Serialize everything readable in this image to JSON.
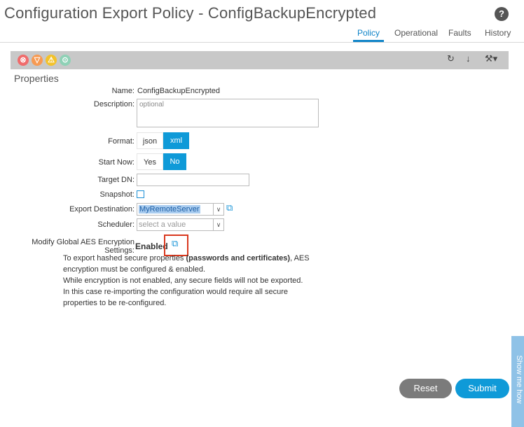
{
  "header": {
    "title": "Configuration Export Policy - ConfigBackupEncrypted",
    "help": "?"
  },
  "tabs": [
    {
      "label": "Policy",
      "active": true
    },
    {
      "label": "Operational",
      "active": false
    },
    {
      "label": "Faults",
      "active": false
    },
    {
      "label": "History",
      "active": false
    }
  ],
  "toolbar": {
    "faults": [
      {
        "icon": "critical-fault-icon",
        "color": "#f06b6b",
        "glyph": "⊗"
      },
      {
        "icon": "major-fault-icon",
        "color": "#f79a52",
        "glyph": "▽"
      },
      {
        "icon": "minor-fault-icon",
        "color": "#f3c22a",
        "glyph": "⚠"
      },
      {
        "icon": "warning-fault-icon",
        "color": "#8fd1b6",
        "glyph": "⊙"
      }
    ],
    "actions": {
      "refresh": "↻",
      "download": "↓",
      "tools": "⚒▾"
    }
  },
  "properties": {
    "section_title": "Properties",
    "name": {
      "label": "Name:",
      "value": "ConfigBackupEncrypted"
    },
    "description": {
      "label": "Description:",
      "placeholder": "optional"
    },
    "format": {
      "label": "Format:",
      "options": [
        "json",
        "xml"
      ],
      "selected": "xml"
    },
    "start_now": {
      "label": "Start Now:",
      "options": [
        "Yes",
        "No"
      ],
      "selected": "No"
    },
    "target_dn": {
      "label": "Target DN:",
      "value": ""
    },
    "snapshot": {
      "label": "Snapshot:",
      "checked": false
    },
    "export_destination": {
      "label": "Export Destination:",
      "value": "MyRemoteServer"
    },
    "scheduler": {
      "label": "Scheduler:",
      "placeholder": "select a value"
    },
    "aes": {
      "label_line1": "Modify Global AES Encryption",
      "label_line2": "Settings:",
      "value": "Enabled"
    },
    "note": {
      "line1_pre": "To export hashed secure properties ",
      "line1_bold": "(passwords and certificates)",
      "line1_post": ", AES",
      "line2": "encryption must be configured & enabled.",
      "line3": "While encryption is not enabled, any secure fields will not be exported.",
      "line4": "In this case re-importing the configuration would require all secure",
      "line5": "properties to be re-configured."
    }
  },
  "footer": {
    "reset": "Reset",
    "submit": "Submit"
  },
  "show_me_how": "Show me how"
}
